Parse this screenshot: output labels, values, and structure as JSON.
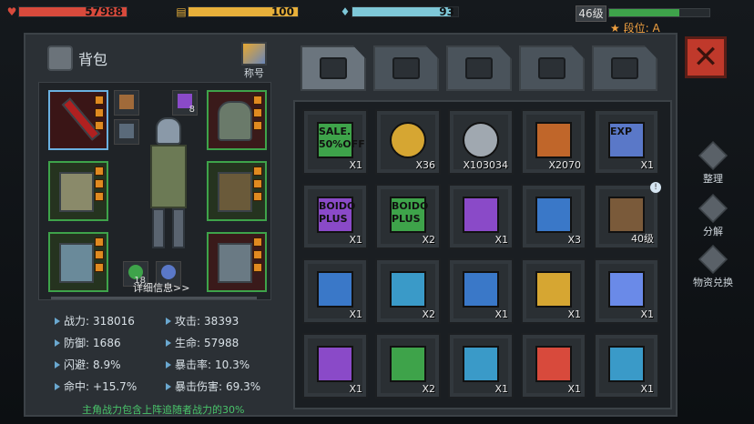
{
  "topbar": {
    "hp_value": "57988",
    "energy_value": "100",
    "water_value": "93",
    "level_label": "46级",
    "rank_label": "段位: A",
    "colors": {
      "hp": "#d84a3c",
      "energy": "#e8b03a",
      "water": "#7ec8d8",
      "xp": "#3ea34a"
    },
    "hp_fill": 1.0,
    "energy_fill": 1.0,
    "water_fill": 0.93,
    "xp_fill": 0.7
  },
  "bag": {
    "title": "背包",
    "title_icon_label": "称号"
  },
  "equipment": {
    "small_slots": [
      "8",
      "18"
    ],
    "detail_link": "详细信息>>"
  },
  "stats": [
    {
      "label": "战力:",
      "value": "318016"
    },
    {
      "label": "攻击:",
      "value": "38393"
    },
    {
      "label": "防御:",
      "value": "1686"
    },
    {
      "label": "生命:",
      "value": "57988"
    },
    {
      "label": "闪避:",
      "value": "8.9%"
    },
    {
      "label": "暴击率:",
      "value": "10.3%"
    },
    {
      "label": "命中:",
      "value": "+15.7%"
    },
    {
      "label": "暴击伤害:",
      "value": "69.3%"
    }
  ],
  "hint": "主角战力包含上阵追随者战力的30%",
  "side_buttons": [
    {
      "label": "整理"
    },
    {
      "label": "分解"
    },
    {
      "label": "物资兑换"
    }
  ],
  "tabs": [
    {
      "name": "backpack-tab",
      "icon": "backpack-icon"
    },
    {
      "name": "medkit-tab",
      "icon": "medkit-icon"
    },
    {
      "name": "armor-tab",
      "icon": "armor-icon"
    },
    {
      "name": "weapon-tab",
      "icon": "gun-icon"
    },
    {
      "name": "material-tab",
      "icon": "wrench-icon"
    }
  ],
  "items": [
    [
      {
        "icon": "sale-ticket-icon",
        "count": "X1",
        "text": "SALE..",
        "sub": "50%OFF",
        "color": "#3ea34a"
      },
      {
        "icon": "gold-coin-icon",
        "count": "X36",
        "color": "#d6a632"
      },
      {
        "icon": "silver-coin-icon",
        "count": "X103034",
        "color": "#a0a8b0"
      },
      {
        "icon": "rank-badge-icon",
        "count": "X2070",
        "color": "#c0662a"
      },
      {
        "icon": "exp-badge-icon",
        "count": "X1",
        "text": "EXP",
        "color": "#5a78c8"
      }
    ],
    [
      {
        "icon": "purple-ticket-icon",
        "count": "X1",
        "text": "BOIDO",
        "sub": "PLUS",
        "color": "#8a4ac8"
      },
      {
        "icon": "green-ticket-icon",
        "count": "X2",
        "text": "BOIDO",
        "sub": "PLUS",
        "color": "#3ea34a"
      },
      {
        "icon": "purple-crate-icon",
        "count": "X1",
        "color": "#8a4ac8"
      },
      {
        "icon": "blue-crate-icon",
        "count": "X3",
        "color": "#3a78c8"
      },
      {
        "icon": "rifle-icon",
        "count": "40级",
        "color": "#7a5a3a",
        "badge": "!"
      }
    ],
    [
      {
        "icon": "blue-device-icon",
        "count": "X1",
        "color": "#3a78c8"
      },
      {
        "icon": "blue-device-icon",
        "count": "X2",
        "color": "#3a9ac8"
      },
      {
        "icon": "blue-device-icon",
        "count": "X1",
        "color": "#3a78c8"
      },
      {
        "icon": "explosion-grenade-icon",
        "count": "X1",
        "color": "#d6a632"
      },
      {
        "icon": "electric-grenade-icon",
        "count": "X1",
        "color": "#6a8ae8"
      }
    ],
    [
      {
        "icon": "purple-device-icon",
        "count": "X1",
        "color": "#8a4ac8"
      },
      {
        "icon": "green-device-icon",
        "count": "X2",
        "color": "#3ea34a"
      },
      {
        "icon": "search-device-icon",
        "count": "X1",
        "color": "#3a9ac8"
      },
      {
        "icon": "fire-grenade-icon",
        "count": "X1",
        "color": "#d84a3c"
      },
      {
        "icon": "blue-device-icon",
        "count": "X1",
        "color": "#3a9ac8"
      }
    ]
  ]
}
